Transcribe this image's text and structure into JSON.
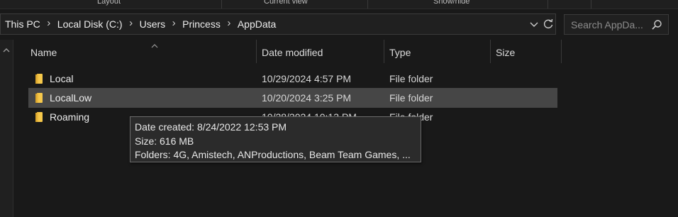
{
  "ribbon": {
    "groups": [
      "Layout",
      "Current view",
      "Show/hide"
    ]
  },
  "address": {
    "breadcrumbs": [
      "This PC",
      "Local Disk (C:)",
      "Users",
      "Princess",
      "AppData"
    ],
    "dropdown_icon": "chevron-down-icon",
    "refresh_icon": "refresh-icon"
  },
  "search": {
    "placeholder": "Search AppDa...",
    "icon": "search-icon"
  },
  "columns": {
    "name": "Name",
    "date_modified": "Date modified",
    "type": "Type",
    "size": "Size"
  },
  "rows": [
    {
      "name": "Local",
      "date": "10/29/2024 4:57 PM",
      "type": "File folder",
      "size": ""
    },
    {
      "name": "LocalLow",
      "date": "10/20/2024 3:25 PM",
      "type": "File folder",
      "size": ""
    },
    {
      "name": "Roaming",
      "date": "10/28/2024 10:13 PM",
      "type": "File folder",
      "size": ""
    }
  ],
  "tooltip": {
    "date_created": "Date created: 8/24/2022 12:53 PM",
    "size": "Size: 616 MB",
    "folders": "Folders: 4G, Amistech, ANProductions, Beam Team Games, ..."
  },
  "colors": {
    "background": "#191919",
    "selected_row": "#464646",
    "folder_yellow": "#f6c84b",
    "tooltip_bg": "#2b2b2b"
  }
}
